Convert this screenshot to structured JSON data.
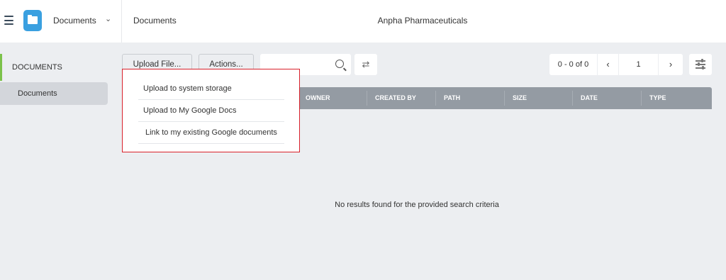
{
  "header": {
    "app_title": "Documents",
    "app_chevron": "⌄",
    "breadcrumb": "Documents",
    "company": "Anpha Pharmaceuticals"
  },
  "sidebar": {
    "section_label": "DOCUMENTS",
    "items": [
      {
        "label": "Documents"
      }
    ]
  },
  "toolbar": {
    "upload_label": "Upload File...",
    "actions_label": "Actions...",
    "search_placeholder": "",
    "refresh_glyph": "⇄"
  },
  "pager": {
    "range": "0 - 0 of 0",
    "prev": "‹",
    "page": "1",
    "next": "›"
  },
  "table": {
    "columns": [
      "OWNER",
      "CREATED BY",
      "PATH",
      "SIZE",
      "DATE",
      "TYPE"
    ],
    "empty_message": "No results found for the provided search criteria"
  },
  "upload_menu": {
    "items": [
      {
        "label": "Upload to system storage"
      },
      {
        "label": "Upload to My Google Docs"
      },
      {
        "label": "Link to my existing Google documents"
      }
    ]
  },
  "colors": {
    "accent_green": "#7cc24b",
    "app_blue": "#3aa0e0",
    "table_header": "#949ba3",
    "highlight_red": "#d9202a"
  }
}
